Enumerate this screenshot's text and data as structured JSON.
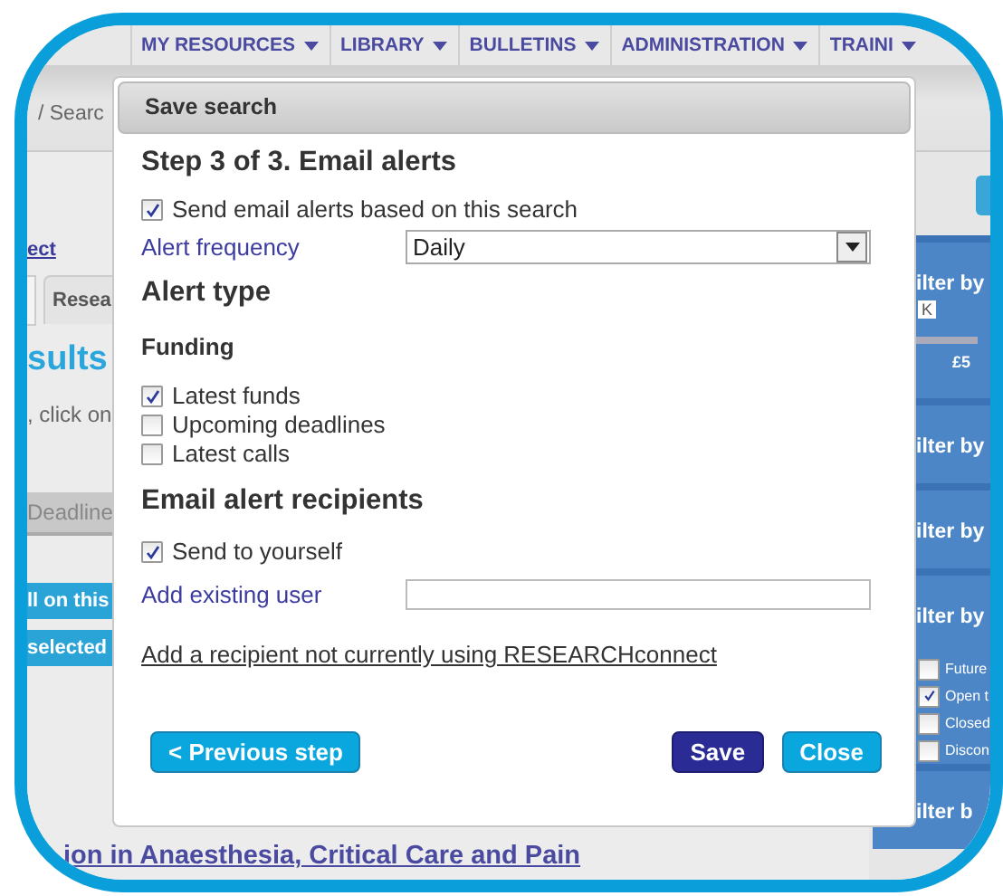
{
  "nav": [
    {
      "label": "MY RESOURCES"
    },
    {
      "label": "LIBRARY"
    },
    {
      "label": "BULLETINS"
    },
    {
      "label": "ADMINISTRATION"
    },
    {
      "label": "TRAINI"
    }
  ],
  "breadcrumb": "/ Searc",
  "main": {
    "link": "ect",
    "tab": "Resea",
    "heading": "sults",
    "hint": ", click on",
    "column": "Deadline",
    "buttons": [
      "ll on this",
      "selected"
    ],
    "result_title": "ion in Anaesthesia, Critical Care and Pain"
  },
  "sidebar": {
    "filters": [
      {
        "kind": "range",
        "title": "ilter by",
        "tag": "K",
        "tick": "£5"
      },
      {
        "kind": "plain",
        "title": "ilter by"
      },
      {
        "kind": "plain",
        "title": "ilter by"
      },
      {
        "kind": "checklist",
        "title": "ilter by",
        "options": [
          {
            "label": "Future",
            "checked": false
          },
          {
            "label": "Open t",
            "checked": true
          },
          {
            "label": "Closed",
            "checked": false
          },
          {
            "label": "Discon",
            "checked": false
          }
        ]
      },
      {
        "kind": "plain",
        "title": "ilter b"
      }
    ]
  },
  "dialog": {
    "title": "Save search",
    "heading": "Step 3 of 3. Email alerts",
    "send_alerts": {
      "label": "Send email alerts based on this search",
      "checked": true
    },
    "frequency": {
      "label": "Alert frequency",
      "value": "Daily"
    },
    "alert_type": {
      "heading": "Alert type",
      "group": "Funding",
      "options": [
        {
          "label": "Latest funds",
          "checked": true
        },
        {
          "label": "Upcoming deadlines",
          "checked": false
        },
        {
          "label": "Latest calls",
          "checked": false
        }
      ]
    },
    "recipients": {
      "heading": "Email alert recipients",
      "self": {
        "label": "Send to yourself",
        "checked": true
      },
      "add_user": {
        "label": "Add existing user"
      },
      "link": "Add a recipient not currently using RESEARCHconnect"
    },
    "buttons": [
      {
        "label": "< Previous step",
        "kind": "back"
      },
      {
        "label": "Save",
        "kind": "primary"
      },
      {
        "label": "Close",
        "kind": "secondary"
      }
    ]
  }
}
